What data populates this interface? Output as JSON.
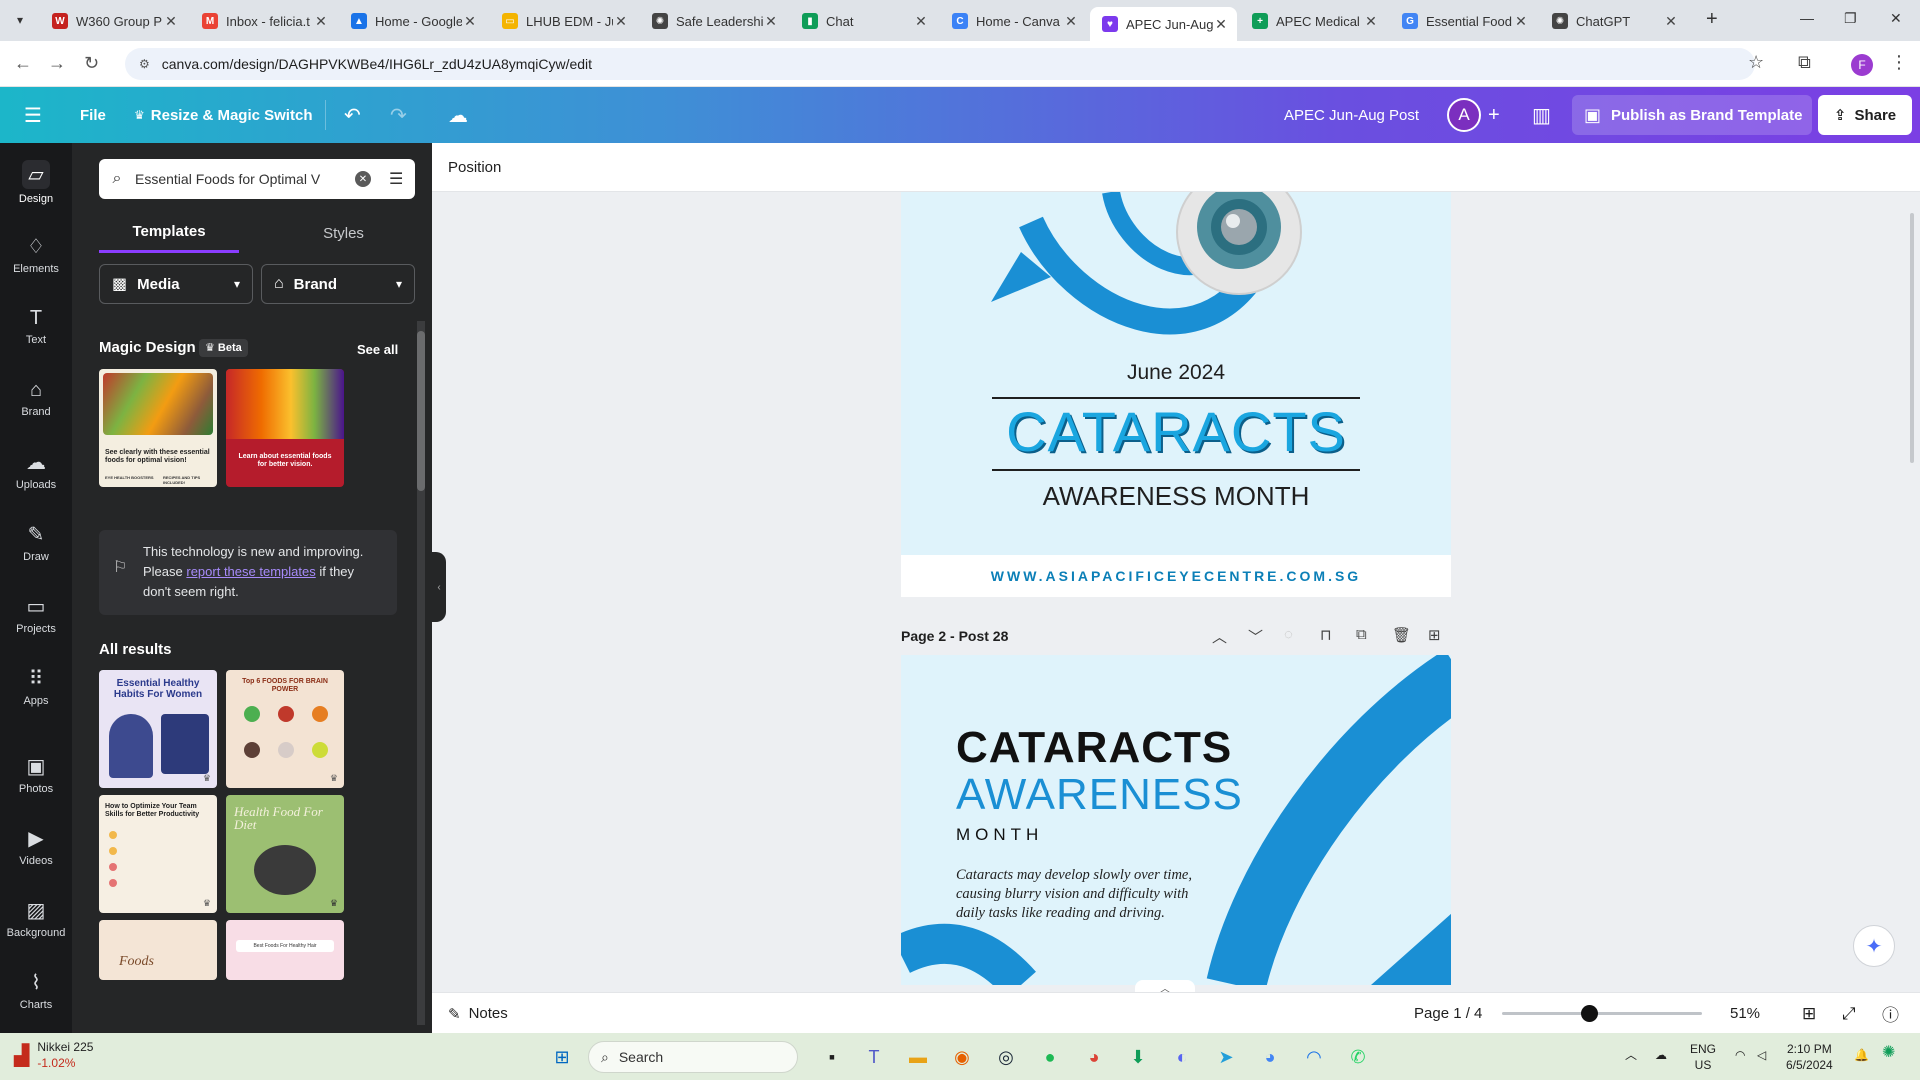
{
  "browser": {
    "tabs": [
      {
        "title": "W360 Group P",
        "fav_color": "#c5221f",
        "fav_glyph": "W"
      },
      {
        "title": "Inbox - felicia.t",
        "fav_color": "#ea4335",
        "fav_glyph": "M"
      },
      {
        "title": "Home - Google",
        "fav_color": "#1a73e8",
        "fav_glyph": "▲"
      },
      {
        "title": "LHUB EDM - Ju",
        "fav_color": "#f4b400",
        "fav_glyph": "▭"
      },
      {
        "title": "Safe Leadership",
        "fav_color": "#444444",
        "fav_glyph": "✺"
      },
      {
        "title": "Chat",
        "fav_color": "#0f9d58",
        "fav_glyph": "▮"
      },
      {
        "title": "Home - Canva",
        "fav_color": "#3b82f6",
        "fav_glyph": "C"
      },
      {
        "title": "APEC Jun-Aug",
        "fav_color": "#7c3aed",
        "fav_glyph": "♥"
      },
      {
        "title": "APEC Medical",
        "fav_color": "#0f9d58",
        "fav_glyph": "+"
      },
      {
        "title": "Essential Food",
        "fav_color": "#4285f4",
        "fav_glyph": "G"
      },
      {
        "title": "ChatGPT",
        "fav_color": "#444444",
        "fav_glyph": "✺"
      }
    ],
    "url": "canva.com/design/DAGHPVKWBe4/IHG6Lr_zdU4zUA8ymqiCyw/edit",
    "profile_initial": "F"
  },
  "topbar": {
    "file": "File",
    "resize": "Resize & Magic Switch",
    "design_title": "APEC Jun-Aug Post",
    "avatar_initial": "A",
    "publish": "Publish as Brand Template",
    "share": "Share"
  },
  "rail": [
    "Design",
    "Elements",
    "Text",
    "Brand",
    "Uploads",
    "Draw",
    "Projects",
    "Apps",
    "Photos",
    "Videos",
    "Background",
    "Charts"
  ],
  "panel": {
    "search_value": "Essential Foods for Optimal V",
    "tabs": [
      "Templates",
      "Styles"
    ],
    "filters": [
      "Media",
      "Brand"
    ],
    "magic_design": "Magic Design",
    "beta": "Beta",
    "see_all": "See all",
    "magic_thumbs": [
      {
        "caption": "See clearly with these essential foods for optimal vision!",
        "foot_left": "EYE HEALTH BOOSTERS",
        "foot_right": "RECIPES AND TIPS INCLUDED!"
      },
      {
        "caption": "Learn about essential foods for better vision."
      }
    ],
    "notice_pre": "This technology is new and improving. Please ",
    "notice_link": "report these templates",
    "notice_post": " if they don't seem right.",
    "all_results": "All results",
    "results": [
      {
        "title": "Essential Healthy Habits For Women"
      },
      {
        "title": "Top 6 FOODS FOR BRAIN POWER"
      },
      {
        "title": "How to Optimize Your Team Skills for Better Productivity"
      },
      {
        "title": "Health Food For Diet"
      },
      {
        "title": "Foods"
      },
      {
        "title": "Best Foods For Healthy Hair"
      }
    ]
  },
  "workspace": {
    "toolbar_label": "Position",
    "page1": {
      "date": "June 2024",
      "headline": "CATARACTS",
      "sub": "AWARENESS MONTH",
      "website": "WWW.ASIAPACIFICEYECENTRE.COM.SG"
    },
    "page2_label": "Page 2 - Post 28",
    "page2": {
      "line1": "CATARACTS",
      "line2": "AWARENESS",
      "line3": "MONTH",
      "body": "Cataracts may develop slowly over time, causing blurry vision and difficulty with daily tasks like reading and driving."
    }
  },
  "bottombar": {
    "notes": "Notes",
    "page": "Page 1 / 4",
    "zoom": "51%",
    "zoom_level": 0.51
  },
  "taskbar": {
    "ticker_name": "Nikkei 225",
    "ticker_change": "-1.02%",
    "search": "Search",
    "lang": "ENG",
    "region": "US",
    "time": "2:10 PM",
    "date": "6/5/2024"
  },
  "colors": {
    "canva_purple": "#8b3dff",
    "ribbon_blue": "#1a8fd4",
    "page_bg": "#dff3fb"
  }
}
